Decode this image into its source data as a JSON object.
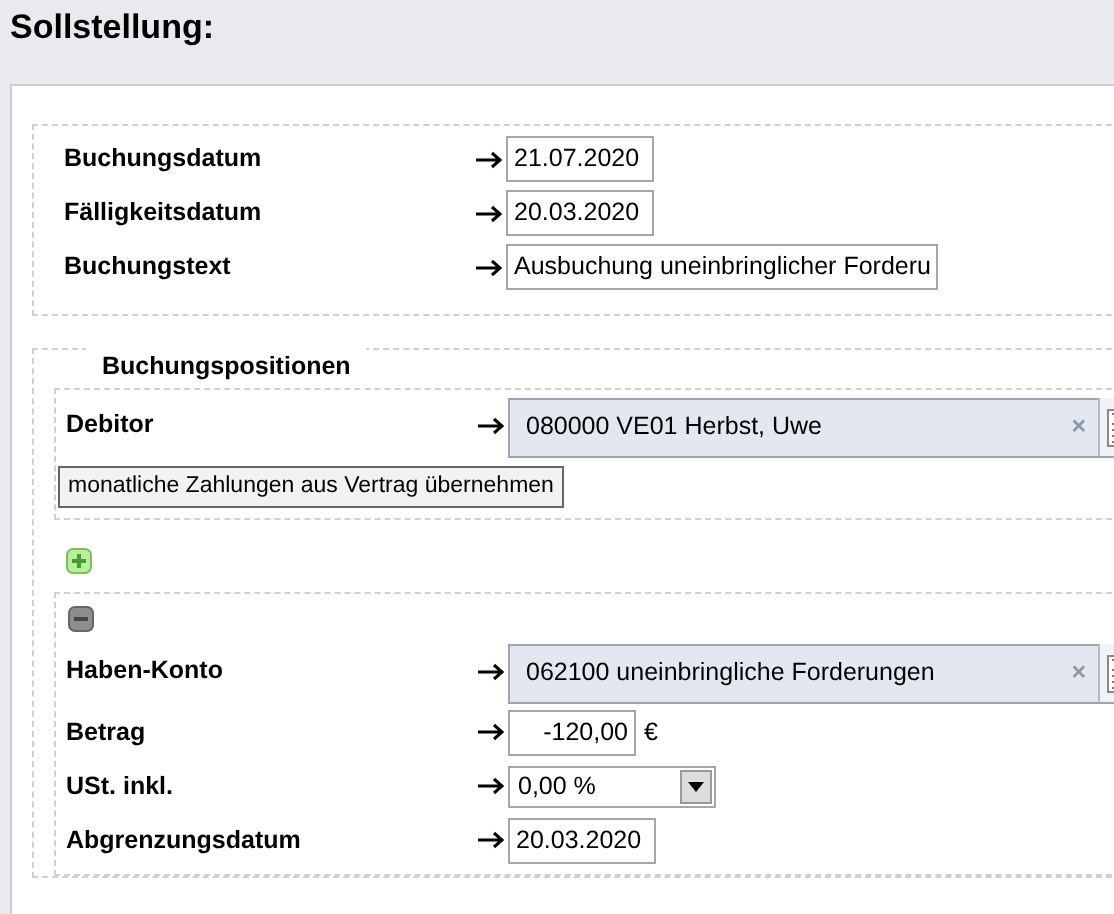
{
  "title": "Sollstellung:",
  "header_rows": [
    {
      "label": "Buchungsdatum",
      "kind": "date",
      "value": "21.07.2020"
    },
    {
      "label": "Fälligkeitsdatum",
      "kind": "date",
      "value": "20.03.2020"
    },
    {
      "label": "Buchungstext",
      "kind": "text",
      "value": "Ausbuchung uneinbringlicher Forderu"
    }
  ],
  "positions": {
    "legend": "Buchungspositionen",
    "debtor_group": {
      "rows": [
        {
          "label": "Debitor",
          "kind": "lookup",
          "value": "080000 VE01 Herbst, Uwe",
          "clear": "×"
        }
      ],
      "action_button": "monatliche Zahlungen aus Vertrag übernehmen"
    },
    "position_group": {
      "rows": [
        {
          "label": "Haben-Konto",
          "kind": "lookup",
          "value": "062100 uneinbringliche Forderungen",
          "clear": "×"
        },
        {
          "label": "Betrag",
          "kind": "amount",
          "value": "-120,00",
          "unit": "€"
        },
        {
          "label": "USt. inkl.",
          "kind": "select",
          "value": "0,00 %"
        },
        {
          "label": "Abgrenzungsdatum",
          "kind": "date",
          "value": "20.03.2020"
        }
      ]
    }
  }
}
